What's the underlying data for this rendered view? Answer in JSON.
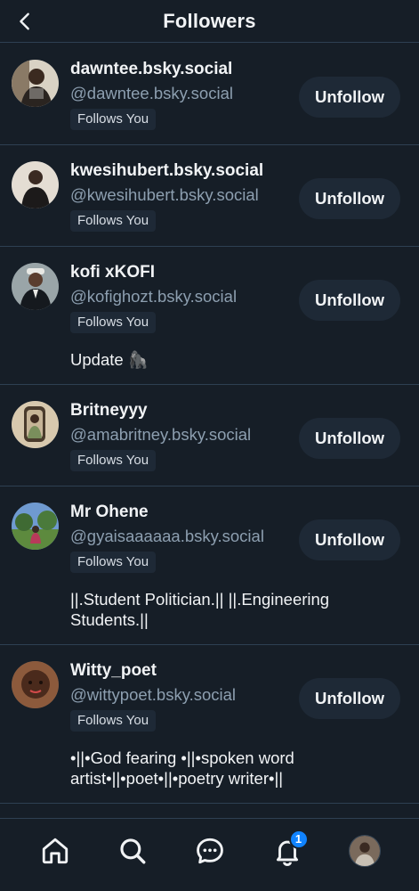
{
  "header": {
    "title": "Followers",
    "back_icon": "chevron-left-icon"
  },
  "followers": [
    {
      "name": "dawntee.bsky.social",
      "handle": "@dawntee.bsky.social",
      "badge": "Follows You",
      "bio": "",
      "button": "Unfollow",
      "avatar_color": "#5a4636"
    },
    {
      "name": "kwesihubert.bsky.social",
      "handle": "@kwesihubert.bsky.social",
      "badge": "Follows You",
      "bio": "",
      "button": "Unfollow",
      "avatar_color": "#c9b9a6"
    },
    {
      "name": "kofi xKOFI",
      "handle": "@kofighozt.bsky.social",
      "badge": "Follows You",
      "bio": "Update 🦍",
      "button": "Unfollow",
      "avatar_color": "#8a9598"
    },
    {
      "name": "Britneyyy",
      "handle": "@amabritney.bsky.social",
      "badge": "Follows You",
      "bio": "",
      "button": "Unfollow",
      "avatar_color": "#c8b89e"
    },
    {
      "name": "Mr Ohene",
      "handle": "@gyaisaaaaaa.bsky.social",
      "badge": "Follows You",
      "bio": "||.Student Politician.|| ||.Engineering\nStudents.||",
      "button": "Unfollow",
      "avatar_color": "#6f94c6"
    },
    {
      "name": "Witty_poet",
      "handle": "@wittypoet.bsky.social",
      "badge": "Follows You",
      "bio": "•||•God fearing •||•spoken word\nartist•||•poet•||•poetry writer•||",
      "button": "Unfollow",
      "avatar_color": "#6a3e2c"
    }
  ],
  "bottom_nav": {
    "items": [
      "home-icon",
      "search-icon",
      "chat-icon",
      "bell-icon",
      "profile-avatar"
    ],
    "notification_count": "1"
  },
  "colors": {
    "background": "#161e27",
    "divider": "#2e4052",
    "button_bg": "#1e2936",
    "handle_text": "#8d9fb0",
    "accent": "#1083fe"
  }
}
